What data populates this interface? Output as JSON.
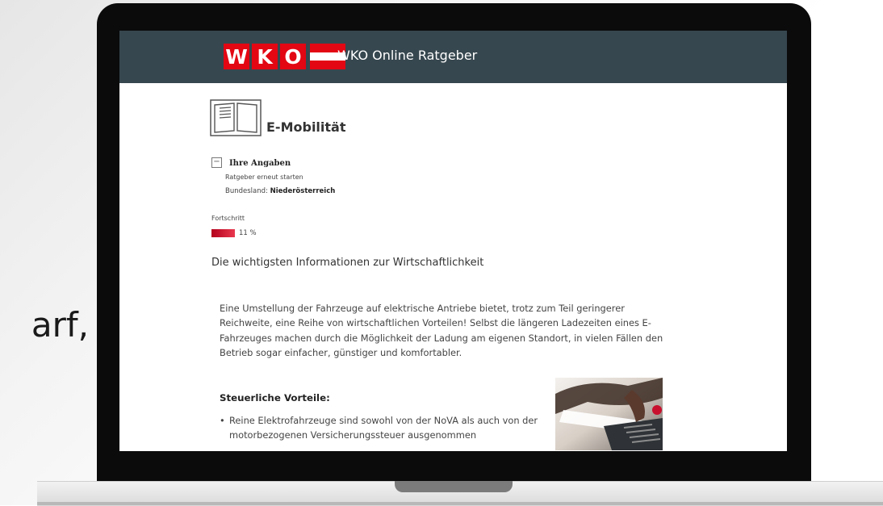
{
  "slide": {
    "partial_text": "arf,"
  },
  "header": {
    "logo_letters": [
      "W",
      "K",
      "O"
    ],
    "title": "WKO Online Ratgeber"
  },
  "page": {
    "title": "E-Mobilität"
  },
  "answers": {
    "toggle_symbol": "−",
    "heading": "Ihre Angaben",
    "restart_label": "Ratgeber erneut starten",
    "bundesland_label": "Bundesland:",
    "bundesland_value": "Niederösterreich"
  },
  "progress": {
    "label": "Fortschritt",
    "value_percent": 11,
    "value_text": "11 %"
  },
  "content": {
    "subheading": "Die wichtigsten Informationen zur Wirtschaftlichkeit",
    "intro": "Eine Umstellung der Fahrzeuge auf elektrische Antriebe bietet, trotz zum Teil geringerer Reichweite, eine Reihe von wirtschaftlichen Vorteilen! Selbst die längeren Ladezeiten eines E-Fahrzeuges machen durch die Möglichkeit der Ladung am eigenen Standort, in vielen Fällen den Betrieb sogar einfacher, günstiger und komfortabler.",
    "tax_heading": "Steuerliche Vorteile:",
    "bullets": [
      "Reine Elektrofahrzeuge sind sowohl von der NoVA als auch von der motorbezogenen Versicherungssteuer ausgenommen"
    ]
  },
  "colors": {
    "header_bg": "#37474f",
    "brand_red": "#e30613",
    "progress_red": "#c8102e"
  },
  "icons": [
    "book-icon",
    "minus-box-icon"
  ]
}
